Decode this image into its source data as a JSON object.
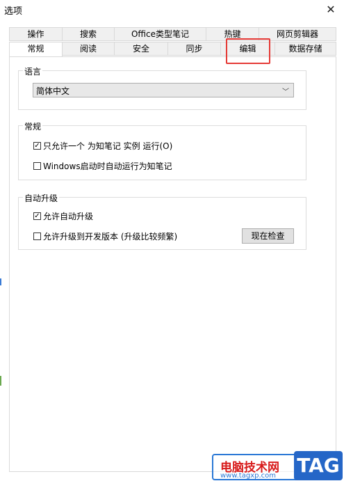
{
  "window": {
    "title": "选项"
  },
  "tabs_top": [
    "操作",
    "搜索",
    "Office类型笔记",
    "热键",
    "网页剪辑器"
  ],
  "tabs_bottom": [
    "常规",
    "阅读",
    "安全",
    "同步",
    "编辑",
    "数据存储"
  ],
  "active_tab": "常规",
  "language": {
    "group_title": "语言",
    "selected": "简体中文"
  },
  "general": {
    "group_title": "常规",
    "single_instance": {
      "label": "只允许一个 为知笔记 实例 运行(O)",
      "checked": true
    },
    "autostart": {
      "label": "Windows启动时自动运行为知笔记",
      "checked": false
    }
  },
  "auto_upgrade": {
    "group_title": "自动升级",
    "allow_auto": {
      "label": "允许自动升级",
      "checked": true
    },
    "allow_dev": {
      "label": "允许升级到开发版本 (升级比较频繁)",
      "checked": false
    },
    "check_now_label": "现在检查"
  },
  "watermark": {
    "text": "电脑技术网",
    "url": "www.tagxp.com",
    "tag": "TAG"
  },
  "colors": {
    "highlight_box": "#e53935",
    "tab_hover": "#cce4f7"
  }
}
